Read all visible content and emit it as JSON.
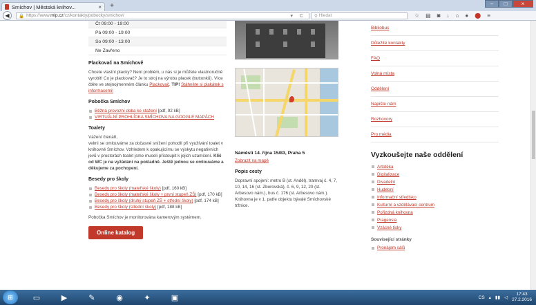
{
  "browser": {
    "tab_title": "Smíchov | Městská knihov...",
    "tab_close": "×",
    "new_tab": "+",
    "url_prefix": "https://www.",
    "url_domain": "mlp.cz",
    "url_path": "/cz/kontakty/pobocky/smichov/",
    "search_placeholder": "Hledat",
    "win_min": "–",
    "win_max": "□",
    "win_close": "×"
  },
  "hours": [
    "Čt  09:00 - 19:00",
    "Pá  09:00 - 19:00",
    "So  09:00 - 13:00",
    "Ne  Zavřeno"
  ],
  "plackovac": {
    "title": "Plackovač na Smíchově",
    "text": "Chcete vlastní placky? Není problém, u nás si je můžete vlastnoručně vyrobit! Co je plackovač? Je to stroj na výrobu placek (buttonků). Více čtěte ve stejnojmenném článku",
    "link": "Plackovač",
    "tip": " TIP!",
    "tip_link": "Stáhněte si plakátek s informacemi!"
  },
  "pobocka": {
    "title": "Pobočka Smíchov",
    "items": [
      {
        "link": "Běžná provozní doba ke stažení",
        "suffix": " [pdf, 92 kB]"
      },
      {
        "link": "VIRTUÁLNÍ PROHLÍDKA SMÍCHOVA NA GOOGLE MAPÁCH",
        "suffix": ""
      }
    ]
  },
  "toalety": {
    "title": "Toalety",
    "greeting": "Vážení čtenáři,",
    "text": "velmi se omlouváme za dočasné snížení pohodlí při využívání toalet v knihovně Smíchov. Vzhledem k opakujícímu se výskytu negativních jevů v prostorách toalet jsme museli přistoupit k jejich uzamčení.",
    "bold1": "Klíč od WC je na vyžádání na pokladně.",
    "bold2": "Ještě jednou se omlouváme a děkujeme za pochopení."
  },
  "besedy": {
    "title": "Besedy pro školy",
    "items": [
      {
        "link": "Besedy pro školy (mateřské školy)",
        "suffix": " [pdf, 160 kB]"
      },
      {
        "link": "Besedy pro školy (mateřské školy + první stupeň ZŠ)",
        "suffix": " [pdf, 170 kB]"
      },
      {
        "link": "Besedy pro školy (druhý stupeň ZŠ + střední školy)",
        "suffix": " [pdf, 174 kB]"
      },
      {
        "link": "Besedy pro školy (střední školy)",
        "suffix": " [pdf, 188 kB]"
      }
    ],
    "camera": "Pobočka Smíchov je monitorována kamerovým systémem."
  },
  "catalog_button": "Online katalog",
  "address": {
    "title": "Náměstí 14. října 15/83, Praha 5",
    "map_link": "Zobrazit na mapě",
    "popis_title": "Popis cesty",
    "popis_text": "Dopravní spojení: metro B (st. Anděl), tramvaj č. 4, 7, 10, 14, 16 (st. Zborovská), č. 6, 9, 12, 20 (st. Arbesovo nám.), bus č. 176 (st. Arbesovo nám.). Knihovna je v 1. patře objektu bývalé Smíchovské tržnice."
  },
  "right_links": [
    "Bibliobus",
    "Důležité kontakty",
    "FAQ",
    "Volná místa",
    "Oddělení",
    "Napište nám",
    "Rozhovory",
    "Pro média"
  ],
  "departments": {
    "title": "Vyzkoušejte naše oddělení",
    "items": [
      "Artotéka",
      "Digitalizace",
      "Divadelní",
      "Hudební",
      "Informační středisko",
      "Kulturní a vzdělávací centrum",
      "Pořizdná knihovna",
      "Pragensia",
      "Vzácné tisky"
    ]
  },
  "related": {
    "title": "Související stránky",
    "items": [
      "Pronájem sálů"
    ]
  },
  "taskbar": {
    "lang": "CS",
    "time": "17:43",
    "date": "27.2.2016"
  }
}
